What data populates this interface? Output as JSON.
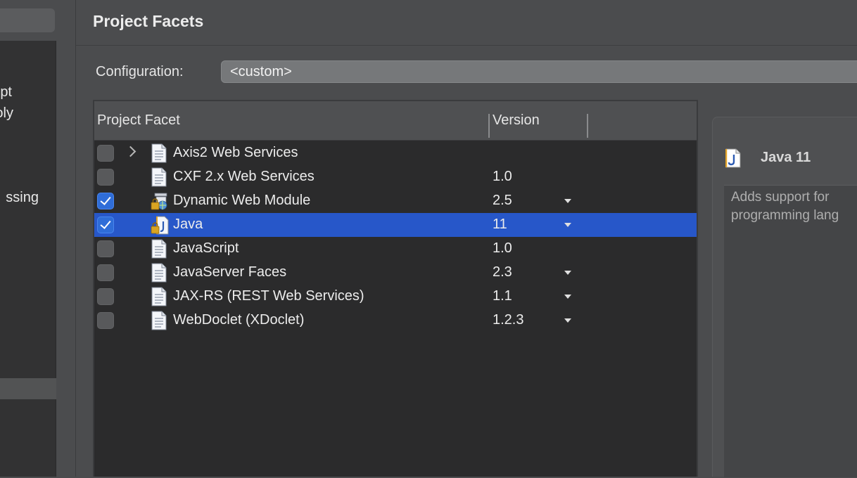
{
  "left_panel": {
    "items": [
      {
        "label": "pt"
      },
      {
        "label": "oly"
      },
      {
        "label": "ssing"
      }
    ]
  },
  "page": {
    "title": "Project Facets"
  },
  "configuration": {
    "label": "Configuration:",
    "value": "<custom>"
  },
  "facet_table": {
    "headers": {
      "facet": "Project Facet",
      "version": "Version"
    },
    "rows": [
      {
        "name": "Axis2 Web Services",
        "version": "",
        "checked": false,
        "expandable": true,
        "has_dropdown": false,
        "icon": "document-icon",
        "selected": false
      },
      {
        "name": "CXF 2.x Web Services",
        "version": "1.0",
        "checked": false,
        "expandable": false,
        "has_dropdown": false,
        "icon": "document-icon",
        "selected": false
      },
      {
        "name": "Dynamic Web Module",
        "version": "2.5",
        "checked": true,
        "expandable": false,
        "has_dropdown": true,
        "icon": "web-module-lock-icon",
        "selected": false
      },
      {
        "name": "Java",
        "version": "11",
        "checked": true,
        "expandable": false,
        "has_dropdown": true,
        "icon": "java-lock-icon",
        "selected": true
      },
      {
        "name": "JavaScript",
        "version": "1.0",
        "checked": false,
        "expandable": false,
        "has_dropdown": false,
        "icon": "document-icon",
        "selected": false
      },
      {
        "name": "JavaServer Faces",
        "version": "2.3",
        "checked": false,
        "expandable": false,
        "has_dropdown": true,
        "icon": "document-icon",
        "selected": false
      },
      {
        "name": "JAX-RS (REST Web Services)",
        "version": "1.1",
        "checked": false,
        "expandable": false,
        "has_dropdown": true,
        "icon": "document-icon",
        "selected": false
      },
      {
        "name": "WebDoclet (XDoclet)",
        "version": "1.2.3",
        "checked": false,
        "expandable": false,
        "has_dropdown": true,
        "icon": "document-icon",
        "selected": false
      }
    ]
  },
  "details": {
    "title": "Java 11",
    "icon": "java-file-icon",
    "description_line1": "Adds support for",
    "description_line2": "programming lang"
  },
  "colors": {
    "selection": "#2757c9",
    "checkbox_checked": "#2f6dd8",
    "table_bg": "#2b2b2c",
    "window_bg": "#4b4c4e"
  }
}
